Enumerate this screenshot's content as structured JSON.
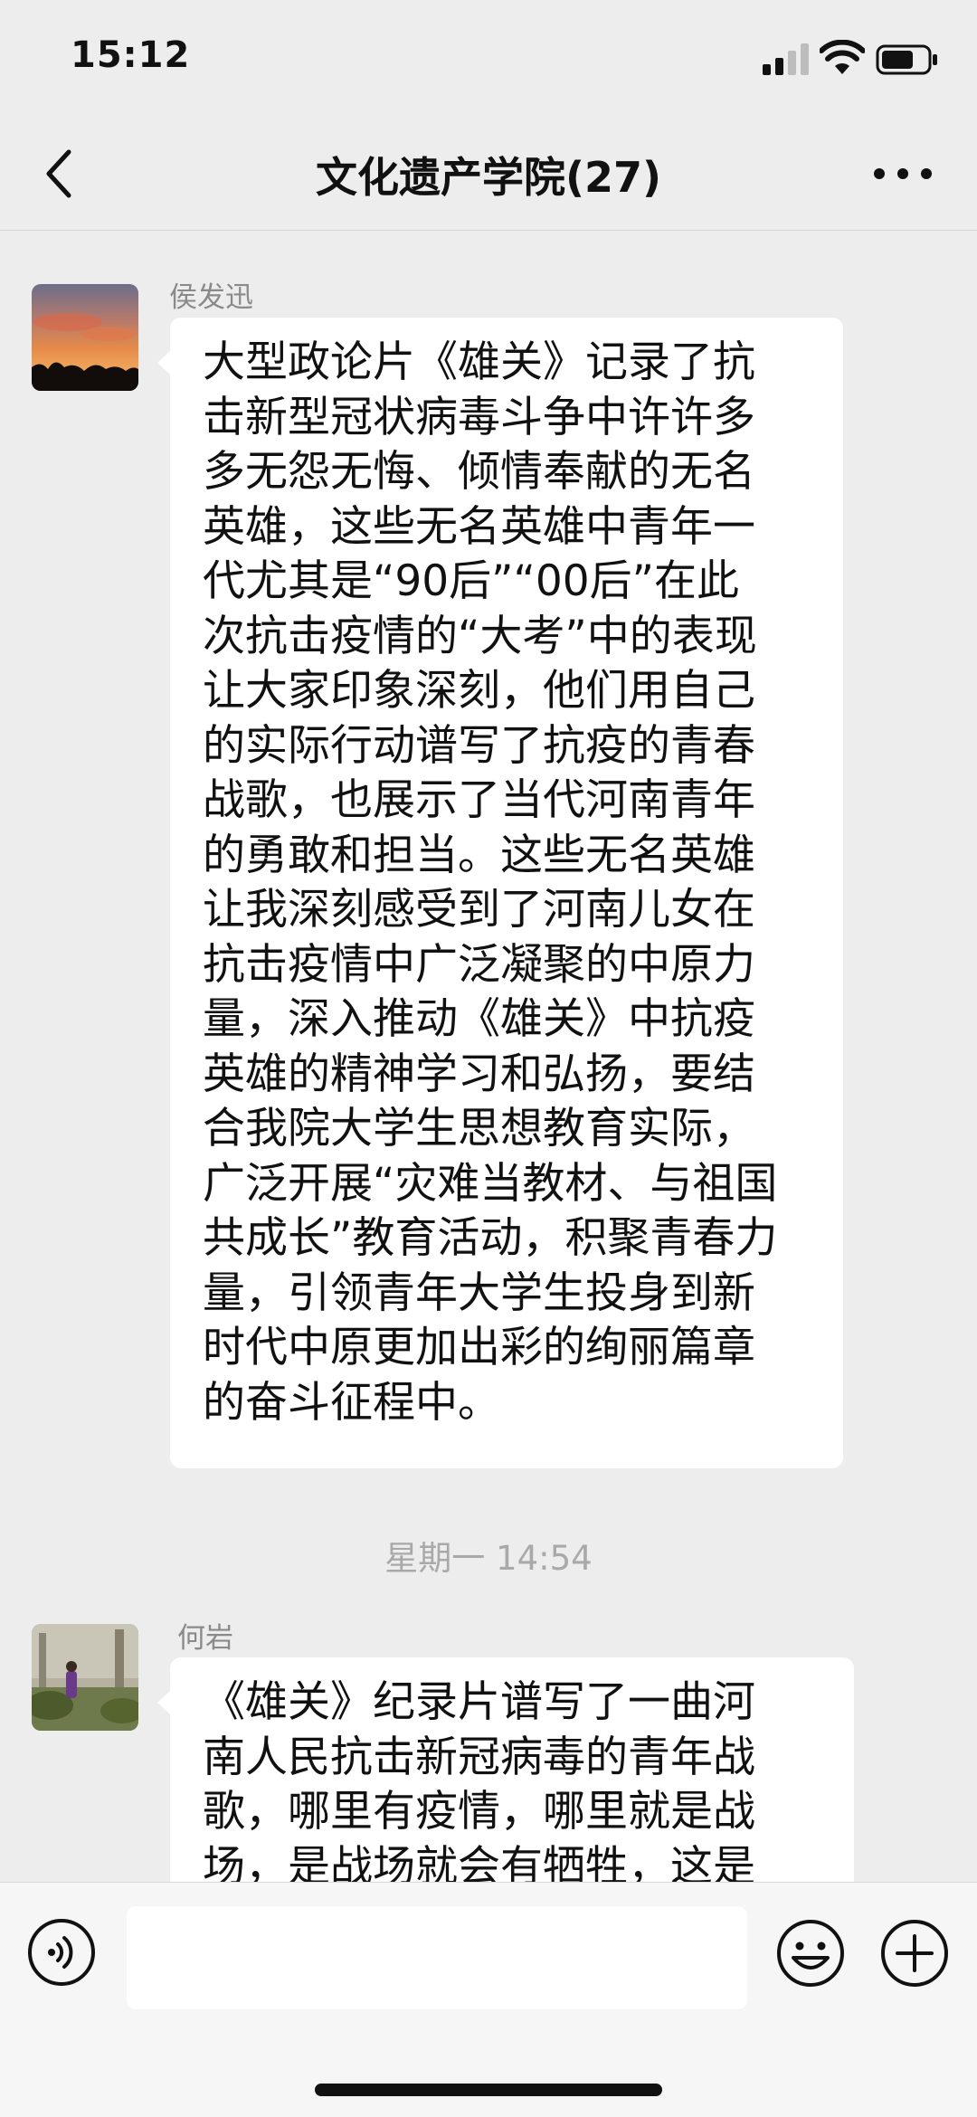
{
  "status_bar": {
    "time": "15:12",
    "icons": [
      "signal-icon",
      "wifi-icon",
      "battery-icon"
    ]
  },
  "nav": {
    "title": "文化遗产学院(27)",
    "back_icon": "chevron-left-icon",
    "more_icon": "more-horizontal-icon"
  },
  "messages": [
    {
      "sender": "侯发迅",
      "avatar": "sunset-photo-avatar",
      "text": "大型政论片《雄关》记录了抗\n击新型冠状病毒斗争中许许多\n多无怨无悔、倾情奉献的无名\n英雄，这些无名英雄中青年一\n代尤其是“90后”“00后”在此\n次抗击疫情的“大考”中的表现\n让大家印象深刻，他们用自己\n的实际行动谱写了抗疫的青春\n战歌，也展示了当代河南青年\n的勇敢和担当。这些无名英雄\n让我深刻感受到了河南儿女在\n抗击疫情中广泛凝聚的中原力\n量，深入推动《雄关》中抗疫\n英雄的精神学习和弘扬，要结\n合我院大学生思想教育实际，\n广泛开展“灾难当教材、与祖国\n共成长”教育活动，积聚青春力\n量，引领青年大学生投身到新\n时代中原更加出彩的绚丽篇章\n的奋斗征程中。"
    },
    {
      "sender": "何岩",
      "avatar": "person-in-park-avatar",
      "text": "《雄关》纪录片谱写了一曲河\n南人民抗击新冠病毒的青年战\n歌，哪里有疫情，哪里就是战\n场，是战场就会有牺牲，这是"
    }
  ],
  "timestamp": "星期一 14:54",
  "input_bar": {
    "placeholder": "",
    "voice_icon": "voice-icon",
    "emoji_icon": "emoji-icon",
    "plus_icon": "plus-circle-icon"
  },
  "colors": {
    "background": "#ededed",
    "bubble": "#ffffff",
    "sender_text": "#8a8a8a",
    "timestamp_text": "#a9a9a9"
  }
}
